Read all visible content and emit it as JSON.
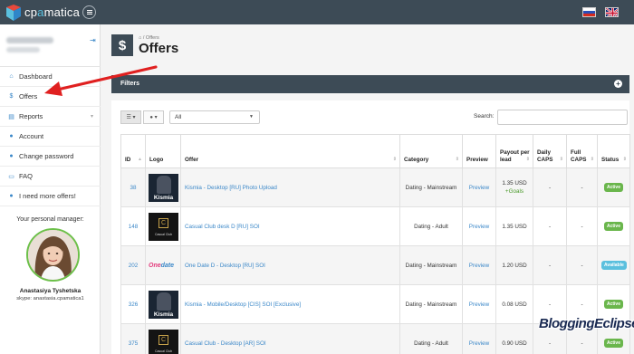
{
  "header": {
    "brand_prefix": "cp",
    "brand_dot": "a",
    "brand_suffix": "matica",
    "logo_icon": "cpamatica-logo",
    "menu_icon": "hamburger-icon",
    "languages": [
      "Russian",
      "English"
    ]
  },
  "sidebar": {
    "logout_icon": "logout-icon",
    "items": [
      {
        "label": "Dashboard",
        "icon": "home-icon"
      },
      {
        "label": "Offers",
        "icon": "dollar-icon"
      },
      {
        "label": "Reports",
        "icon": "file-icon",
        "has_submenu": true
      },
      {
        "label": "Account",
        "icon": "user-icon"
      },
      {
        "label": "Change password",
        "icon": "user-icon"
      },
      {
        "label": "FAQ",
        "icon": "comment-icon"
      },
      {
        "label": "I need more offers!",
        "icon": "user-icon"
      }
    ],
    "manager": {
      "heading": "Your personal manager:",
      "name": "Anastasiya Tyshetska",
      "skype": "skype: anastasia.cpamatica1"
    }
  },
  "main": {
    "breadcrumb_sep": "/",
    "breadcrumb": "Offers",
    "page_icon": "$",
    "title": "Offers",
    "filters_title": "Filters",
    "filter_select": "All",
    "search_label": "Search:",
    "search_value": "",
    "columns": [
      "ID",
      "Logo",
      "Offer",
      "Category",
      "Preview",
      "Payout per lead",
      "Daily CAPS",
      "Full CAPS",
      "Status"
    ],
    "rows": [
      {
        "id": "38",
        "logo": "Kismia",
        "offer": "Kismia - Desktop [RU] Photo Upload",
        "category": "Dating - Mainstream",
        "preview": "Preview",
        "payout": "1.35 USD",
        "payout_extra": "+Goals",
        "daily": "-",
        "full": "-",
        "status": "Active"
      },
      {
        "id": "148",
        "logo": "Casual Club",
        "offer": "Casual Club desk D [RU] SOI",
        "category": "Dating - Adult",
        "preview": "Preview",
        "payout": "1.35 USD",
        "payout_extra": "",
        "daily": "-",
        "full": "-",
        "status": "Active"
      },
      {
        "id": "202",
        "logo": "Onedate",
        "offer": "One Date D - Desktop [RU] SOI",
        "category": "Dating - Mainstream",
        "preview": "Preview",
        "payout": "1.20 USD",
        "payout_extra": "",
        "daily": "-",
        "full": "-",
        "status": "Available"
      },
      {
        "id": "326",
        "logo": "Kismia",
        "offer": "Kismia - Mobile/Desktop [CIS] SOI [Exclusive]",
        "category": "Dating - Mainstream",
        "preview": "Preview",
        "payout": "0.08 USD",
        "payout_extra": "",
        "daily": "-",
        "full": "-",
        "status": "Active"
      },
      {
        "id": "375",
        "logo": "Casual Club",
        "offer": "Casual Club - Desktop [AR] SOI",
        "category": "Dating - Adult",
        "preview": "Preview",
        "payout": "0.90 USD",
        "payout_extra": "",
        "daily": "-",
        "full": "-",
        "status": "Active"
      }
    ]
  },
  "watermark": "BloggingEclipse",
  "colors": {
    "topbar": "#3d4b56",
    "accent": "#3a87c8",
    "active": "#6ab64c",
    "available": "#5bc0de",
    "arrow": "#e02020"
  }
}
